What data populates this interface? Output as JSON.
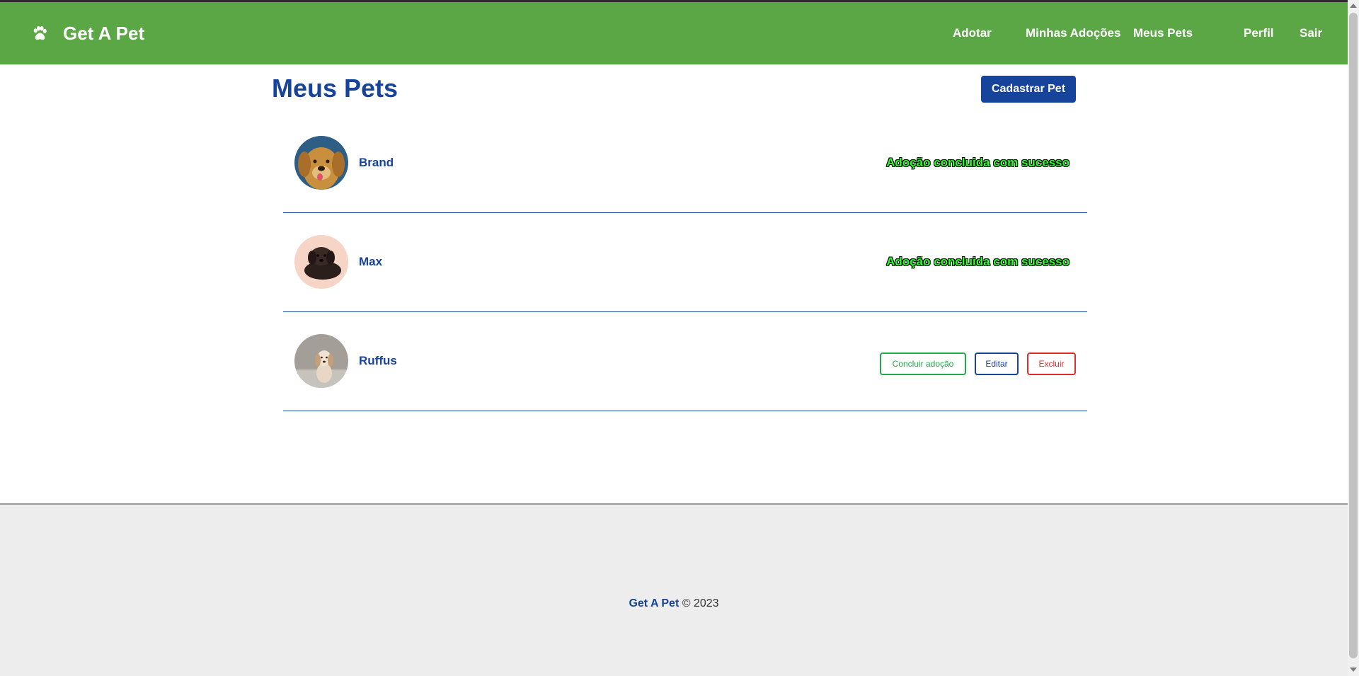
{
  "navbar": {
    "brand": "Get A Pet",
    "links": [
      "Adotar",
      "Minhas Adoções",
      "Meus Pets",
      "Perfil",
      "Sair"
    ]
  },
  "page": {
    "title": "Meus Pets",
    "add_button": "Cadastrar Pet"
  },
  "pets": [
    {
      "name": "Brand",
      "status": "Adoção concluida com sucesso"
    },
    {
      "name": "Max",
      "status": "Adoção concluida com sucesso"
    },
    {
      "name": "Ruffus",
      "actions": {
        "conclude": "Concluir adoção",
        "edit": "Editar",
        "delete": "Excluir"
      }
    }
  ],
  "footer": {
    "brand": "Get A Pet",
    "copyright": "© 2023"
  },
  "colors": {
    "navbar": "#5ba745",
    "primary": "#16449a",
    "success_text": "#29ff29",
    "conclude": "#23a94a",
    "delete": "#e22a2a",
    "footer_bg": "#ededed"
  }
}
